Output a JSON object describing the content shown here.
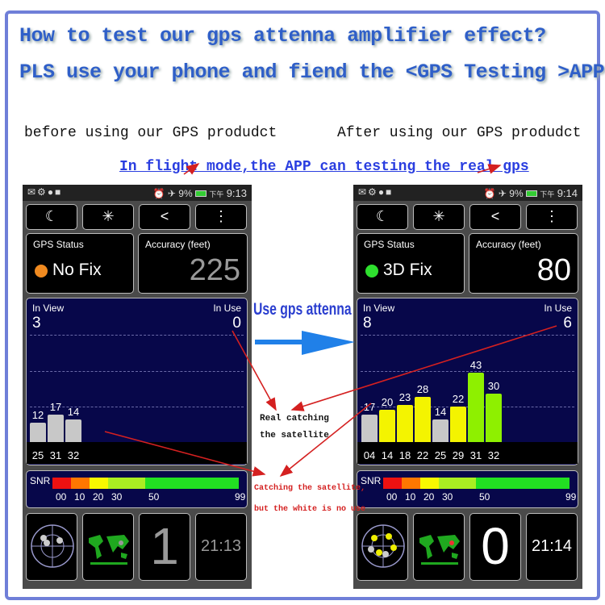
{
  "title_line1": "How to test our gps attenna amplifier effect?",
  "title_line2": "PLS use your phone and fiend the <GPS Testing >APP",
  "caption_before": "before using our GPS produdct",
  "caption_after": "After using our GPS produdct",
  "flight_note": "In flight mode,the APP can testing the real gps",
  "middle_label": "Use gps attenna",
  "note_real": [
    "Real catching",
    "the satellite"
  ],
  "note_white": [
    "Catching the satellite,",
    "but the white is no use"
  ],
  "colors": {
    "accent_blue": "#2f5fc8",
    "arrow_red": "#d42020",
    "bar_gray": "#c8c8c8",
    "bar_yellow": "#f4f400",
    "bar_green": "#8ef000"
  },
  "toolbar_icons": [
    "moon-icon",
    "brightness-icon",
    "share-icon",
    "more-vert-icon"
  ],
  "snr": {
    "label": "SNR",
    "ticks": [
      "00",
      "10",
      "20",
      "30",
      "50",
      "99"
    ]
  },
  "phones": [
    {
      "status": {
        "battery": "9%",
        "ampm": "下午",
        "time": "9:13"
      },
      "gps_status_label": "GPS Status",
      "gps_status": "No Fix",
      "status_color": "#f08a20",
      "accuracy_label": "Accuracy (feet)",
      "accuracy": "225",
      "in_view_label": "In View",
      "in_view": "3",
      "in_use_label": "In Use",
      "in_use": "0",
      "sats": [
        {
          "prn": "25",
          "snr": 12,
          "used": false
        },
        {
          "prn": "31",
          "snr": 17,
          "used": false
        },
        {
          "prn": "32",
          "snr": 14,
          "used": false
        }
      ],
      "fix_count": "1",
      "clock": "21:13"
    },
    {
      "status": {
        "battery": "9%",
        "ampm": "下午",
        "time": "9:14"
      },
      "gps_status_label": "GPS Status",
      "gps_status": "3D Fix",
      "status_color": "#2ee02e",
      "accuracy_label": "Accuracy (feet)",
      "accuracy": "80",
      "in_view_label": "In View",
      "in_view": "8",
      "in_use_label": "In Use",
      "in_use": "6",
      "sats": [
        {
          "prn": "04",
          "snr": 17,
          "used": false
        },
        {
          "prn": "14",
          "snr": 20,
          "used": true
        },
        {
          "prn": "18",
          "snr": 23,
          "used": true
        },
        {
          "prn": "22",
          "snr": 28,
          "used": true
        },
        {
          "prn": "25",
          "snr": 14,
          "used": false
        },
        {
          "prn": "29",
          "snr": 22,
          "used": true
        },
        {
          "prn": "31",
          "snr": 43,
          "used": true
        },
        {
          "prn": "32",
          "snr": 30,
          "used": true
        }
      ],
      "fix_count": "0",
      "clock": "21:14"
    }
  ]
}
